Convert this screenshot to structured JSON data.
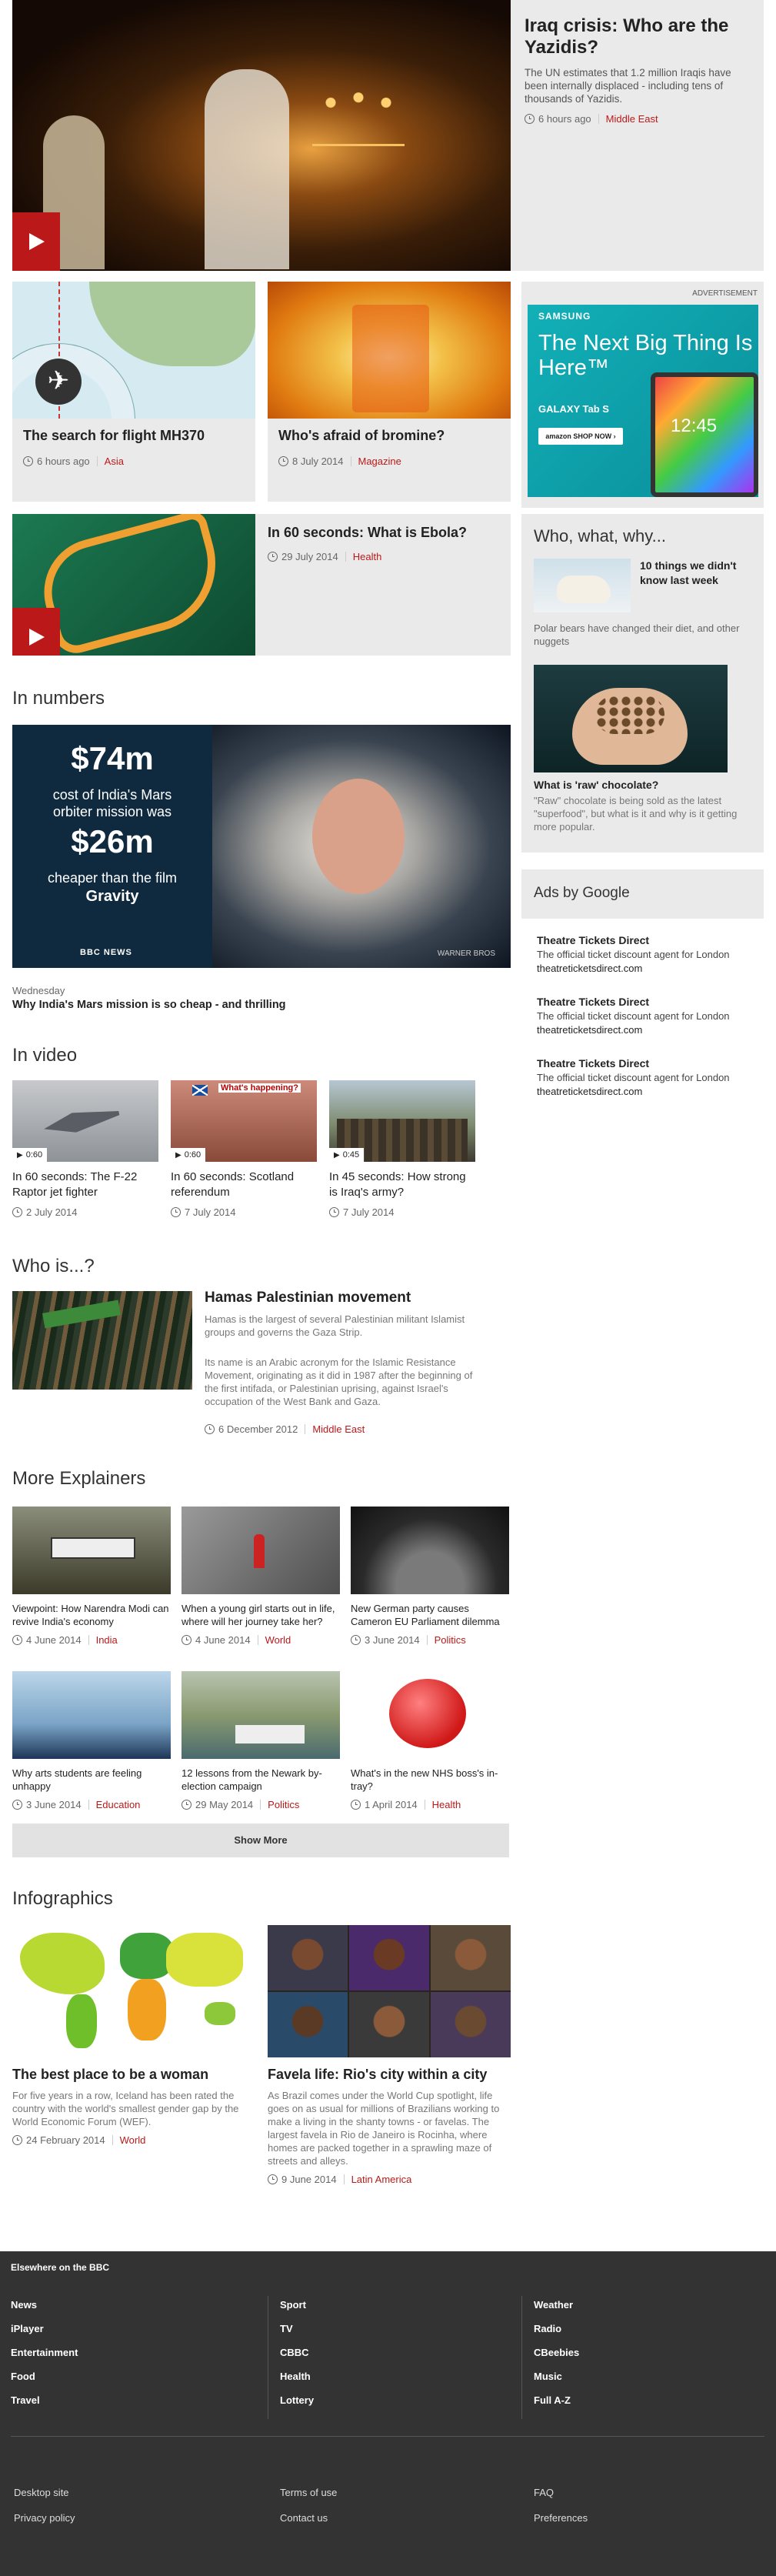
{
  "hero": {
    "title": "Iraq crisis: Who are the Yazidis?",
    "summary": "The UN estimates that 1.2 million Iraqis have been internally displaced - including tens of thousands of Yazidis.",
    "time": "6 hours ago",
    "tag": "Middle East"
  },
  "mh370": {
    "title": "The search for flight MH370",
    "time": "6 hours ago",
    "tag": "Asia"
  },
  "bromine": {
    "title": "Who's afraid of bromine?",
    "time": "8 July 2014",
    "tag": "Magazine"
  },
  "ebola": {
    "title": "In 60 seconds: What is Ebola?",
    "time": "29 July 2014",
    "tag": "Health"
  },
  "ad": {
    "label": "ADVERTISEMENT",
    "brand": "SAMSUNG",
    "headline": "The Next Big Thing Is Here™",
    "product": "GALAXY Tab S",
    "cta": "amazon SHOP NOW ›",
    "clock": "12:45"
  },
  "www": {
    "heading": "Who, what, why...",
    "t1": "10 things we didn't know last week",
    "d1": "Polar bears have changed their diet, and other nuggets",
    "t2": "What is 'raw' chocolate?",
    "d2": "\"Raw\" chocolate is being sold as the latest \"superfood\", but what is it and why is it getting more popular."
  },
  "numbers": {
    "heading": "In numbers",
    "big1": "$74m",
    "line1": "cost of India's Mars orbiter mission was",
    "big2": "$26m",
    "line2": "cheaper than the film",
    "film": "Gravity",
    "logo": "BBC NEWS",
    "credit": "WARNER BROS",
    "kicker": "Wednesday",
    "title": "Why India's Mars mission is so cheap - and thrilling"
  },
  "adsgoogle": {
    "heading": "Ads by Google",
    "items": [
      {
        "title": "Theatre Tickets Direct",
        "desc": "The official ticket discount agent for London",
        "url": "theatreticketsdirect.com"
      },
      {
        "title": "Theatre Tickets Direct",
        "desc": "The official ticket discount agent for London",
        "url": "theatreticketsdirect.com"
      },
      {
        "title": "Theatre Tickets Direct",
        "desc": "The official ticket discount agent for London",
        "url": "theatreticketsdirect.com"
      }
    ]
  },
  "video": {
    "heading": "In video",
    "items": [
      {
        "dur": "0:60",
        "title": "In 60 seconds: The F-22 Raptor jet fighter",
        "date": "2 July 2014"
      },
      {
        "dur": "0:60",
        "title": "In 60 seconds: Scotland referendum",
        "date": "7 July 2014",
        "overlay": "What's happening?"
      },
      {
        "dur": "0:45",
        "title": "In 45 seconds: How strong is Iraq's army?",
        "date": "7 July 2014"
      }
    ]
  },
  "whois": {
    "heading": "Who is...?",
    "title": "Hamas Palestinian movement",
    "p1": "Hamas is the largest of several Palestinian militant Islamist groups and governs the Gaza Strip.",
    "p2": "Its name is an Arabic acronym for the Islamic Resistance Movement, originating as it did in 1987 after the beginning of the first intifada, or Palestinian uprising, against Israel's occupation of the West Bank and Gaza.",
    "date": "6 December 2012",
    "tag": "Middle East"
  },
  "explainers": {
    "heading": "More Explainers",
    "items": [
      {
        "title": "Viewpoint: How Narendra Modi can revive India's economy",
        "date": "4 June 2014",
        "tag": "India"
      },
      {
        "title": "When a young girl starts out in life, where will her journey take her?",
        "date": "4 June 2014",
        "tag": "World"
      },
      {
        "title": "New German party causes Cameron EU Parliament dilemma",
        "date": "3 June 2014",
        "tag": "Politics"
      },
      {
        "title": "Why arts students are feeling unhappy",
        "date": "3 June 2014",
        "tag": "Education"
      },
      {
        "title": "12 lessons from the Newark by-election campaign",
        "date": "29 May 2014",
        "tag": "Politics"
      },
      {
        "title": "What's in the new NHS boss's in-tray?",
        "date": "1 April 2014",
        "tag": "Health"
      }
    ],
    "more": "Show More"
  },
  "infographics": {
    "heading": "Infographics",
    "i1": {
      "title": "The best place to be a woman",
      "desc": "For five years in a row, Iceland has been rated the country with the world's smallest gender gap by the World Economic Forum (WEF).",
      "date": "24 February 2014",
      "tag": "World"
    },
    "i2": {
      "title": "Favela life: Rio's city within a city",
      "desc": "As Brazil comes under the World Cup spotlight, life goes on as usual for millions of Brazilians working to make a living in the shanty towns - or favelas. The largest favela in Rio de Janeiro is Rocinha, where homes are packed together in a sprawling maze of streets and alleys.",
      "date": "9 June 2014",
      "tag": "Latin America"
    }
  },
  "footer": {
    "heading": "Elsewhere on the BBC",
    "col1": [
      "News",
      "iPlayer",
      "Entertainment",
      "Food",
      "Travel"
    ],
    "col2": [
      "Sport",
      "TV",
      "CBBC",
      "Health",
      "Lottery"
    ],
    "col3": [
      "Weather",
      "Radio",
      "CBeebies",
      "Music",
      "Full A-Z"
    ],
    "b1": [
      "Desktop site",
      "Privacy policy"
    ],
    "b2": [
      "Terms of use",
      "Contact us"
    ],
    "b3": [
      "FAQ",
      "Preferences"
    ]
  },
  "colors": {
    "accent": "#bb1919",
    "card": "#eaeaea",
    "footer": "#333333"
  }
}
